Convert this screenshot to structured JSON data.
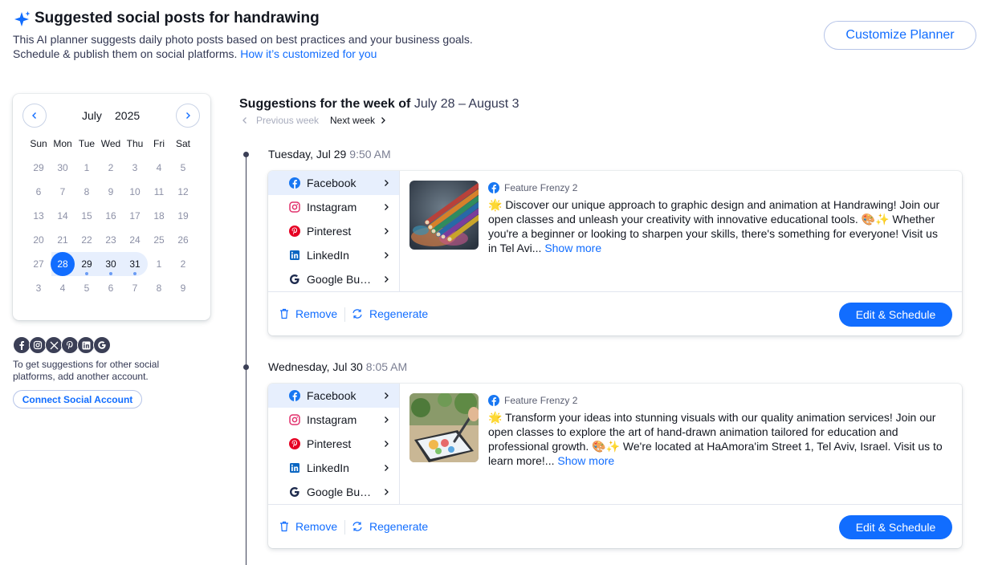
{
  "header": {
    "title": "Suggested social posts for handrawing",
    "desc_line1": "This AI planner suggests daily photo posts based on best practices and your business goals.",
    "desc_line2": "Schedule & publish them on social platforms.",
    "desc_link": "How it’s customized for you",
    "customize_label": "Customize Planner"
  },
  "calendar": {
    "month": "July",
    "year": "2025",
    "weekdays": [
      "Sun",
      "Mon",
      "Tue",
      "Wed",
      "Thu",
      "Fri",
      "Sat"
    ],
    "weeks": [
      [
        "29",
        "30",
        "1",
        "2",
        "3",
        "4",
        "5"
      ],
      [
        "6",
        "7",
        "8",
        "9",
        "10",
        "11",
        "12"
      ],
      [
        "13",
        "14",
        "15",
        "16",
        "17",
        "18",
        "19"
      ],
      [
        "20",
        "21",
        "22",
        "23",
        "24",
        "25",
        "26"
      ],
      [
        "27",
        "28",
        "29",
        "30",
        "31",
        "1",
        "2"
      ],
      [
        "3",
        "4",
        "5",
        "6",
        "7",
        "8",
        "9"
      ]
    ],
    "selected": "28"
  },
  "social": {
    "icons": [
      "facebook-icon",
      "instagram-icon",
      "x-icon",
      "pinterest-icon",
      "linkedin-icon",
      "google-icon"
    ],
    "note_line1": "To get suggestions for other social",
    "note_line2": "platforms, add another account.",
    "connect_label": "Connect Social Account"
  },
  "week": {
    "title_bold": "Suggestions for the week of",
    "range": "July 28 – August 3",
    "prev_label": "Previous week",
    "next_label": "Next week"
  },
  "platforms": [
    "Facebook",
    "Instagram",
    "Pinterest",
    "LinkedIn",
    "Google Bu…"
  ],
  "colors": {
    "accent": "#116dff",
    "facebook": "#1877f2",
    "instagram": "#e1306c",
    "pinterest": "#e60023",
    "linkedin": "#0a66c2"
  },
  "posts": [
    {
      "date": "Tuesday, Jul 29",
      "time": "9:50 AM",
      "account": "Feature Frenzy 2",
      "text": "🌟 Discover our unique approach to graphic design and animation at Handrawing! Join our open classes and unleash your creativity with innovative educational tools. 🎨✨ Whether you're a beginner or looking to sharpen your skills, there's something for everyone! Visit us in Tel Avi...",
      "show_more": "Show more",
      "remove_label": "Remove",
      "regenerate_label": "Regenerate",
      "edit_label": "Edit & Schedule"
    },
    {
      "date": "Wednesday, Jul 30",
      "time": "8:05 AM",
      "account": "Feature Frenzy 2",
      "text": "🌟 Transform your ideas into stunning visuals with our quality animation services! Join our open classes to explore the art of hand-drawn animation tailored for education and professional growth. 🎨✨ We're located at HaAmora'im Street 1, Tel Aviv, Israel. Visit us to learn more!...",
      "show_more": "Show more",
      "remove_label": "Remove",
      "regenerate_label": "Regenerate",
      "edit_label": "Edit & Schedule"
    }
  ]
}
